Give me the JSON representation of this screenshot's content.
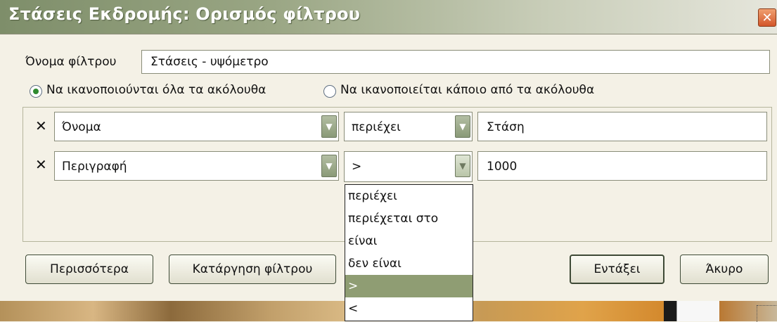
{
  "window": {
    "title": "Στάσεις Εκδρομής: Ορισμός φίλτρου",
    "close_glyph": "✕"
  },
  "filter_name": {
    "label": "Όνομα φίλτρου",
    "value": "Στάσεις - υψόμετρο"
  },
  "match_options": [
    {
      "label": "Να ικανοποιούνται όλα τα ακόλουθα",
      "checked": true
    },
    {
      "label": "Να ικανοποιείται κάποιο από τα ακόλουθα",
      "checked": false
    }
  ],
  "rules": [
    {
      "remove_glyph": "✕",
      "field": "Όνομα",
      "operator": "περιέχει",
      "value": "Στάση"
    },
    {
      "remove_glyph": "✕",
      "field": "Περιγραφή",
      "operator": ">",
      "value": "1000"
    }
  ],
  "operator_dropdown": {
    "options": [
      "περιέχει",
      "περιέχεται στο",
      "είναι",
      "δεν είναι",
      ">",
      "<"
    ],
    "selected_index": 4
  },
  "buttons": {
    "more": "Περισσότερα",
    "remove_filter": "Κατάργηση φίλτρου",
    "ok": "Εντάξει",
    "cancel": "Άκυρο"
  },
  "icons": {
    "remove": "x-mark-icon",
    "dropdown": "chevron-down-icon",
    "close": "close-icon",
    "radio": "radio-icon"
  },
  "colors": {
    "accent": "#8f9d73",
    "titlebar_start": "#7e8e6a",
    "radio_dot": "#2f8a2f",
    "close": "#d3562a"
  }
}
